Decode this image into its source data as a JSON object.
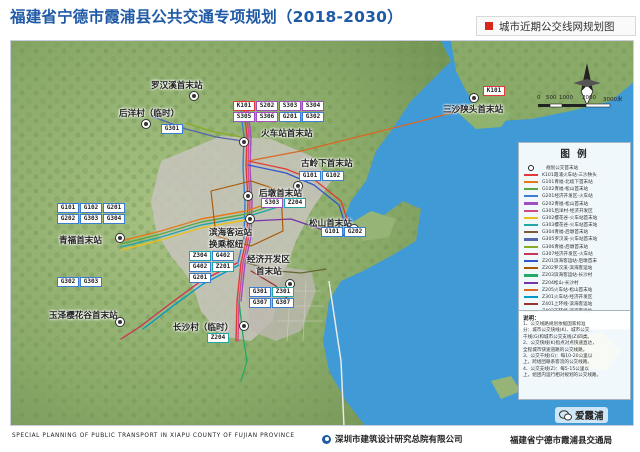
{
  "header": {
    "title": "福建省宁德市霞浦县公共交通专项规划（2018-2030）",
    "subtitle": "城市近期公交线网规划图",
    "subtitle_marker_color": "#d9261c",
    "title_color": "#1f5aa6"
  },
  "compass": {
    "icon": "north-arrow-icon"
  },
  "scale": {
    "labels": [
      "0",
      "500",
      "1000",
      "2000",
      "3000米"
    ]
  },
  "places": {
    "luohan_xi": "罗汉溪首末站",
    "houyang": "后洋村（临时）",
    "huochezhan": "火车站首末站",
    "gulingxia": "古岭下首末站",
    "houdun": "后墩首末站",
    "binhai_1": "滨海客运站",
    "binhai_2": "换乘枢纽",
    "qingfu": "青福首末站",
    "songshan": "松山首末站",
    "jingji_1": "经济开发区",
    "jingji_2": "首末站",
    "yuze": "玉泽樱花谷首末站",
    "changsha": "长沙村（临时）",
    "sansha": "三沙陕头首末站"
  },
  "route_tags": {
    "luohan": [
      "K101",
      "S202",
      "S303",
      "S304",
      "S305",
      "S306",
      "G201",
      "G302"
    ],
    "houyang": [
      "G301"
    ],
    "gulingxia": [
      "G101",
      "G102"
    ],
    "houdun": [
      "S303",
      "Z204"
    ],
    "qingfu": [
      "G101",
      "G102",
      "G201",
      "G202",
      "G303",
      "G304"
    ],
    "songshan": [
      "G101",
      "G202"
    ],
    "binhai": [
      "Z304",
      "G402",
      "G402",
      "Z201",
      "G201"
    ],
    "jingji": [
      "G301",
      "Z301",
      "G307",
      "G307"
    ],
    "yuze": [
      "G302",
      "G303"
    ],
    "changsha": [
      "Z204"
    ],
    "sansha": [
      "K101"
    ]
  },
  "legend": {
    "title": "图 例",
    "items": [
      {
        "label": "规划公交首末站",
        "color": "#222222",
        "kind": "stop"
      },
      {
        "label": "K101霞浦火车站-三沙陕头",
        "color": "#e03a3a"
      },
      {
        "label": "G101青福-北岐下首末站",
        "color": "#e67a1a"
      },
      {
        "label": "G102青福-松山首末站",
        "color": "#5aa844"
      },
      {
        "label": "G201经济开发区-火车站",
        "color": "#3a7dd1"
      },
      {
        "label": "G202青福-松山首末站",
        "color": "#a04fc0"
      },
      {
        "label": "G301后洋村-经济开发区",
        "color": "#d14a8a"
      },
      {
        "label": "G302樱花谷-火车站首末站",
        "color": "#e8c01d"
      },
      {
        "label": "G303樱花谷-火车站首末站",
        "color": "#22a6a6"
      },
      {
        "label": "G304青福-后墩首末站",
        "color": "#7f5a3a"
      },
      {
        "label": "G305罗汉溪-火车站首末站",
        "color": "#5566aa"
      },
      {
        "label": "G306青福-后墩首末站",
        "color": "#88aa22"
      },
      {
        "label": "G307经济开发区-火车站",
        "color": "#cc3355"
      },
      {
        "label": "Z201滨海客运站-后墩首末",
        "color": "#3355cc"
      },
      {
        "label": "Z202罗汉溪-滨海客运站",
        "color": "#aa5500"
      },
      {
        "label": "Z203滨海客运站-长沙村",
        "color": "#22aa66"
      },
      {
        "label": "Z204松山-长沙村",
        "color": "#7733aa"
      },
      {
        "label": "Z205火车站-松山首末站",
        "color": "#dd6622"
      },
      {
        "label": "Z301火车站-经济开发区",
        "color": "#0099cc"
      },
      {
        "label": "Z401上环线-滨海客运站",
        "color": "#993333"
      },
      {
        "label": "Z402下环线-滨海客运站",
        "color": "#666633"
      }
    ]
  },
  "notes": {
    "heading": "说明：",
    "lines": [
      "1、公交线路规划依据国家标准",
      "分：城市公交快线(K)、城市公交",
      "干线(G)和城市公交支线(Z)四类。",
      "2、公交快线(K)指点对点快速直达，",
      "全程城市快速道路的公交线路。",
      "3、公交干线(G)：每10-20公里以",
      "上，跨组团联系客流的公交线路。",
      "4、公交支线(Z)：每5-15公里以",
      "上，组团内运行相对规划的公交线路。"
    ]
  },
  "water_labels": {
    "label": ""
  },
  "footer": {
    "english": "SPECIAL PLANNING OF PUBLIC TRANSPORT IN XIAPU COUNTY OF FUJIAN PROVINCE",
    "org1": "深圳市建筑设计研究总院有限公司",
    "org2": "福建省宁德市霞浦县交通局"
  },
  "watermark": {
    "text": "爱霞浦",
    "icon": "wechat-icon"
  },
  "colors": {
    "sea": "#4da3d8",
    "land": "#8fb26e",
    "urban": "#c9c6c0"
  }
}
